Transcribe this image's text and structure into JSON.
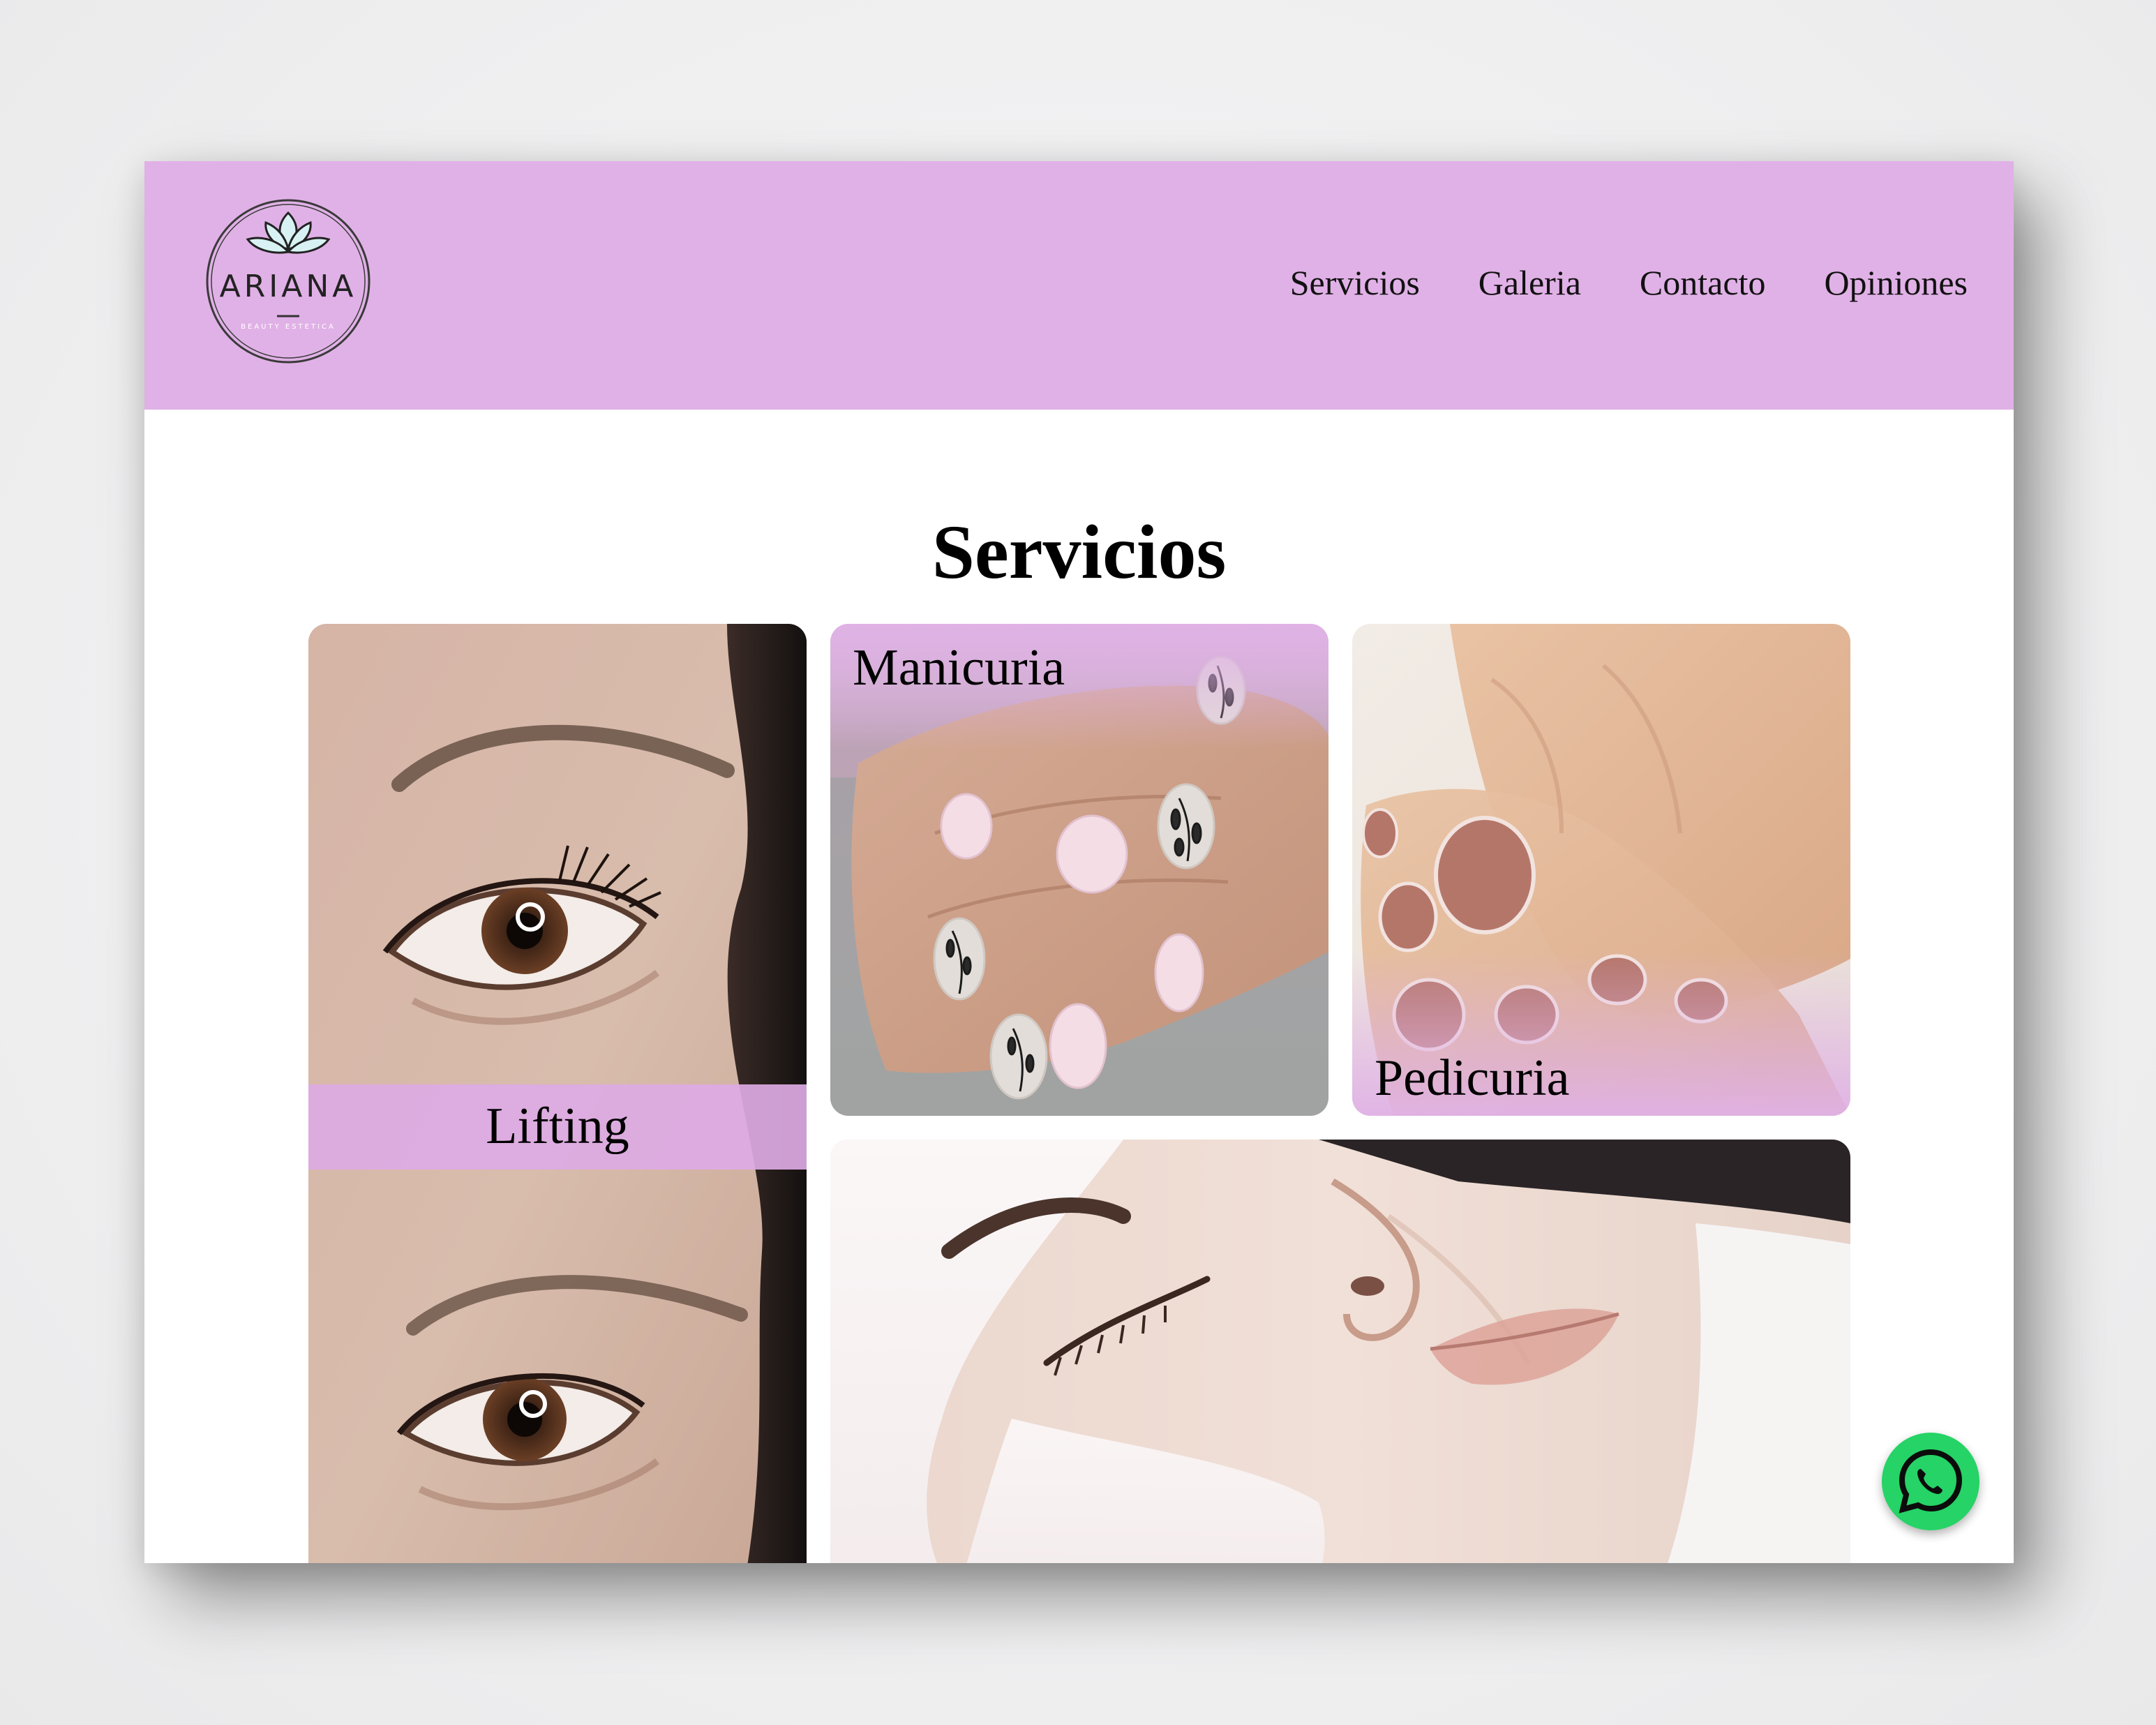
{
  "brand": {
    "name": "ARIANA",
    "tagline": "BEAUTY ESTETICA",
    "accent": "#e0b1e6",
    "logo_icon": "lotus-icon"
  },
  "nav": {
    "items": [
      {
        "label": "Servicios"
      },
      {
        "label": "Galeria"
      },
      {
        "label": "Contacto"
      },
      {
        "label": "Opiniones"
      }
    ]
  },
  "main": {
    "section_title": "Servicios",
    "cards": [
      {
        "label": "Lifting"
      },
      {
        "label": "Manicuria"
      },
      {
        "label": "Pedicuria"
      },
      {
        "label": ""
      }
    ]
  },
  "floating": {
    "whatsapp_icon": "whatsapp-icon",
    "color": "#25d366"
  }
}
